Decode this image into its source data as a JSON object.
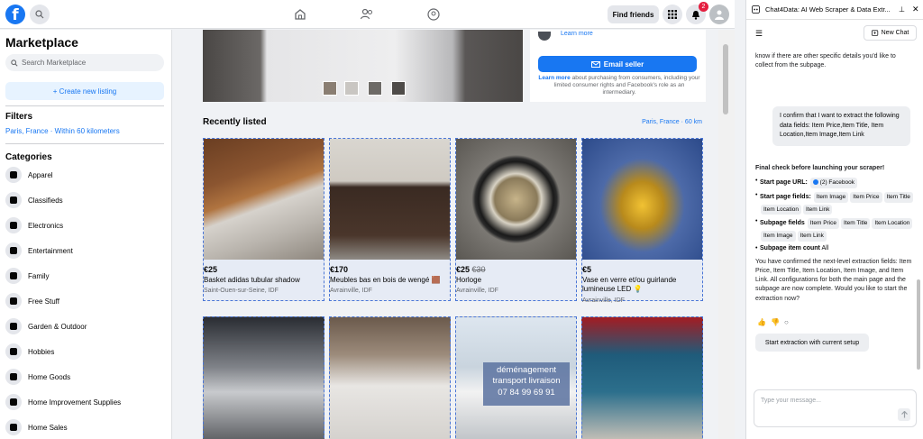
{
  "nav": {
    "find_friends": "Find friends",
    "notification_count": "2"
  },
  "sidebar": {
    "title": "Marketplace",
    "search_placeholder": "Search Marketplace",
    "create_listing": "+ Create new listing",
    "filters_heading": "Filters",
    "filter_location": "Paris, France · Within 60 kilometers",
    "categories_heading": "Categories",
    "categories": [
      {
        "label": "Apparel",
        "icon": "shirt-icon"
      },
      {
        "label": "Classifieds",
        "icon": "tag-icon"
      },
      {
        "label": "Electronics",
        "icon": "phone-icon"
      },
      {
        "label": "Entertainment",
        "icon": "people-icon"
      },
      {
        "label": "Family",
        "icon": "heart-icon"
      },
      {
        "label": "Free Stuff",
        "icon": "tag-icon"
      },
      {
        "label": "Garden & Outdoor",
        "icon": "garden-icon"
      },
      {
        "label": "Hobbies",
        "icon": "guitar-icon"
      },
      {
        "label": "Home Goods",
        "icon": "home-icon"
      },
      {
        "label": "Home Improvement Supplies",
        "icon": "tools-icon"
      },
      {
        "label": "Home Sales",
        "icon": "house-icon"
      }
    ]
  },
  "main": {
    "learn_more": "Learn more",
    "email_seller": "Email seller",
    "learn_more_bold": "Learn more",
    "purchase_note": "about purchasing from consumers, including your limited consumer rights and Facebook's role as an intermediary.",
    "recent_title": "Recently listed",
    "recent_location": "Paris, France · 60 km",
    "listings": [
      {
        "price": "€25",
        "old_price": "",
        "title": "Basket adidas tubular shadow",
        "location": "Saint-Ouen-sur-Seine, IDF"
      },
      {
        "price": "€170",
        "old_price": "",
        "title": "Meubles bas en bois de wengé 🟫",
        "location": "Avrainville, IDF"
      },
      {
        "price": "€25",
        "old_price": "€30",
        "title": "Horloge",
        "location": "Avrainville, IDF"
      },
      {
        "price": "€5",
        "old_price": "",
        "title": "Vase en verre et/ou guirlande lumineuse LED 💡",
        "location": "Avrainville, IDF"
      }
    ],
    "van_text": [
      "déménagement",
      "transport livraison",
      "07 84 99 69 91"
    ]
  },
  "extension": {
    "title": "Chat4Data: AI Web Scraper & Data Extr...",
    "new_chat": "New Chat",
    "intro_text": "know if there are other specific details you'd like to collect from the subpage.",
    "user_message": "I confirm that I want to extract the following data fields: Item Price,Item Title, Item Location,Item Image,Item Link",
    "check_heading": "Final check before launching your scraper!",
    "start_url_label": "Start page URL:",
    "start_url_value": "(2) Facebook",
    "start_fields_label": "Start page fields:",
    "start_fields": [
      "Item Image",
      "Item Price",
      "Item Title",
      "Item Location",
      "Item Link"
    ],
    "subpage_fields_label": "Subpage fields",
    "subpage_fields": [
      "Item Price",
      "Item Title",
      "Item Location",
      "Item Image",
      "Item Link"
    ],
    "subpage_count_label": "Subpage item count",
    "subpage_count_value": "All",
    "confirm_text": "You have confirmed the next-level extraction fields: Item Price, Item Title, Item Location, Item Image, and Item Link. All configurations for both the main page and the subpage are now complete. Would you like to start the extraction now?",
    "start_button": "Start extraction with current setup",
    "message_placeholder": "Type your message..."
  }
}
